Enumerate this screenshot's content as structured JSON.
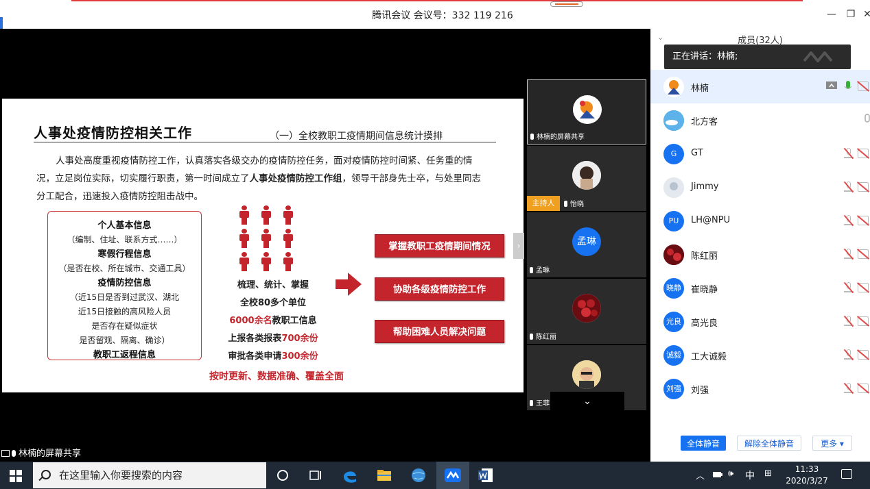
{
  "window": {
    "title": "腾讯会议 会议号：332 119 216",
    "minimize": "—",
    "restore": "❐",
    "close": "✕"
  },
  "slide": {
    "heading": "人事处疫情防控相关工作",
    "subheading": "（一）全校教职工疫情期间信息统计摸排",
    "para1": "人事处高度重视疫情防控工作，认真落实各级交办的疫情防控任务，面对疫情防控时间紧、任务重的情况，立足岗位实际，切实履行职责，第一时间成立了",
    "para_bold": "人事处疫情防控工作组",
    "para2": "，领导干部身先士卒，与处里同志分工配合，迅速投入疫情防控阻击战中。",
    "box": {
      "h1": "个人基本信息",
      "n1": "（编制、住址、联系方式……）",
      "h2": "寒假行程信息",
      "n2": "（是否在校、所在城市、交通工具）",
      "h3": "疫情防控信息",
      "n3": "（近15日是否到过武汉、湖北",
      "n4": "近15日接触的高风险人员",
      "n5": "是否存在疑似症状",
      "n6": "是否留观、隔离、确诊）",
      "h4": "教职工返程信息"
    },
    "mid": {
      "l1": "梳理、统计、掌握",
      "l2": "全校80多个单位",
      "l3_red": "6000余名",
      "l3": "教职工信息",
      "l4": "上报各类报表",
      "l4_red": "700余份",
      "l5": "审批各类申请",
      "l5_red": "300余份"
    },
    "bottom": "按时更新、数据准确、覆盖全面",
    "buttons": [
      "掌握教职工疫情期间情况",
      "协助各级疫情防控工作",
      "帮助困难人员解决问题"
    ],
    "accent": "#c4242b"
  },
  "share_label": "林楠的屏幕共享",
  "video_tiles": [
    {
      "caption": "林楠的屏幕共享"
    },
    {
      "caption": "怡晓",
      "host": "主持人"
    },
    {
      "caption": "孟琳",
      "avatar_text": "孟琳"
    },
    {
      "caption": "陈红丽"
    },
    {
      "caption": "王菲"
    }
  ],
  "collapse_arrow": "›",
  "down_arrow": "⌄",
  "panel": {
    "chevron": "⌄",
    "header": "成员(32人)",
    "speaking": "正在讲话：林楠;",
    "participants": [
      {
        "name": "林楠",
        "avatar": ""
      },
      {
        "name": "北方客",
        "avatar": ""
      },
      {
        "name": "GT",
        "avatar": "G"
      },
      {
        "name": "Jimmy",
        "avatar": ""
      },
      {
        "name": "LH@NPU",
        "avatar": "PU"
      },
      {
        "name": "陈红丽",
        "avatar": ""
      },
      {
        "name": "崔晓静",
        "avatar": "晓静"
      },
      {
        "name": "高光良",
        "avatar": "光良"
      },
      {
        "name": "工大诚毅",
        "avatar": "诚毅"
      },
      {
        "name": "刘强",
        "avatar": "刘强"
      }
    ],
    "mute_all": "全体静音",
    "unmute_all": "解除全体静音",
    "more": "更多 ▾"
  },
  "taskbar": {
    "search_placeholder": "在这里输入你要搜索的内容",
    "ime": "中",
    "time": "11:33",
    "date": "2020/3/27",
    "up_arrow": "︿",
    "volume": "🕪",
    "grid": "⊞"
  }
}
